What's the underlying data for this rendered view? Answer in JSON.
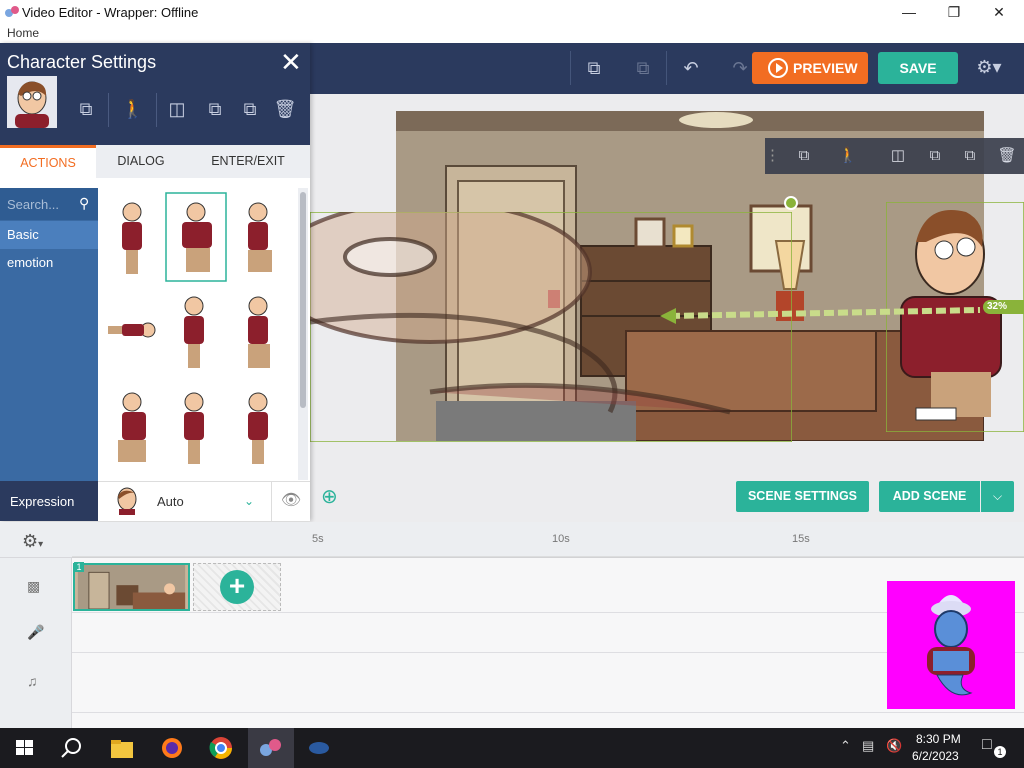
{
  "window": {
    "title": "Video Editor - Wrapper: Offline",
    "menu_home": "Home"
  },
  "toolbar": {
    "preview_label": "PREVIEW",
    "save_label": "SAVE"
  },
  "panel": {
    "title": "Character Settings",
    "tabs": [
      "ACTIONS",
      "DIALOG",
      "ENTER/EXIT"
    ],
    "search_placeholder": "Search...",
    "categories": [
      "Basic",
      "emotion"
    ],
    "expression_label": "Expression",
    "expression_value": "Auto"
  },
  "stage": {
    "scene_settings_label": "SCENE SETTINGS",
    "add_scene_label": "ADD SCENE",
    "scale_badge": "32%"
  },
  "timeline": {
    "ticks": [
      "5s",
      "10s",
      "15s"
    ],
    "scene_number": "1"
  },
  "taskbar": {
    "time": "8:30 PM",
    "date": "6/2/2023",
    "notification_count": "1"
  },
  "colors": {
    "accent_orange": "#f26d22",
    "accent_teal": "#2bb39a",
    "navy": "#2b3a5e",
    "category_blue": "#3a6aa3"
  }
}
